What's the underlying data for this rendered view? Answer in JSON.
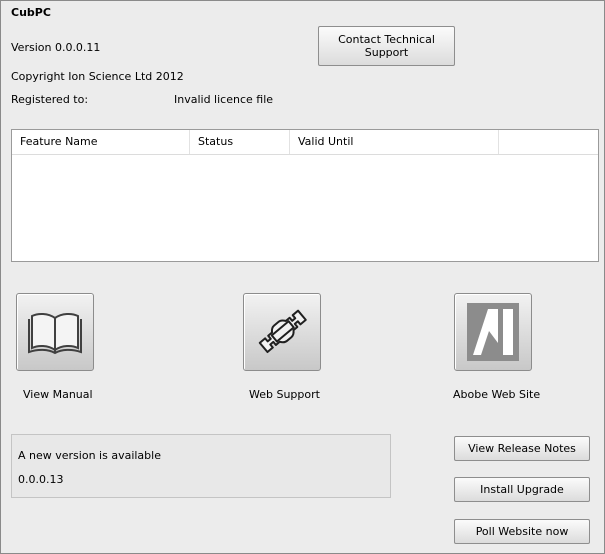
{
  "app": {
    "name": "CubPC",
    "version": "Version 0.0.0.11",
    "copyright": "Copyright Ion Science Ltd 2012",
    "registered_label": "Registered to:",
    "registered_value": "Invalid licence file"
  },
  "buttons": {
    "contact_support": "Contact Technical Support",
    "view_release_notes": "View Release Notes",
    "install_upgrade": "Install Upgrade",
    "poll_website": "Poll Website now"
  },
  "features_table": {
    "columns": [
      "Feature Name",
      "Status",
      "Valid Until",
      ""
    ],
    "rows": []
  },
  "links": {
    "manual": {
      "label": "View Manual",
      "icon": "book-icon"
    },
    "web_support": {
      "label": "Web Support",
      "icon": "wrench-icon"
    },
    "adobe": {
      "label": "Abobe Web Site",
      "icon": "adobe-icon"
    }
  },
  "update_notice": {
    "message": "A new version is available",
    "version": "0.0.0.13"
  },
  "colors": {
    "window_bg": "#ececec",
    "adobe_icon_fg": "#8c8c8c"
  }
}
